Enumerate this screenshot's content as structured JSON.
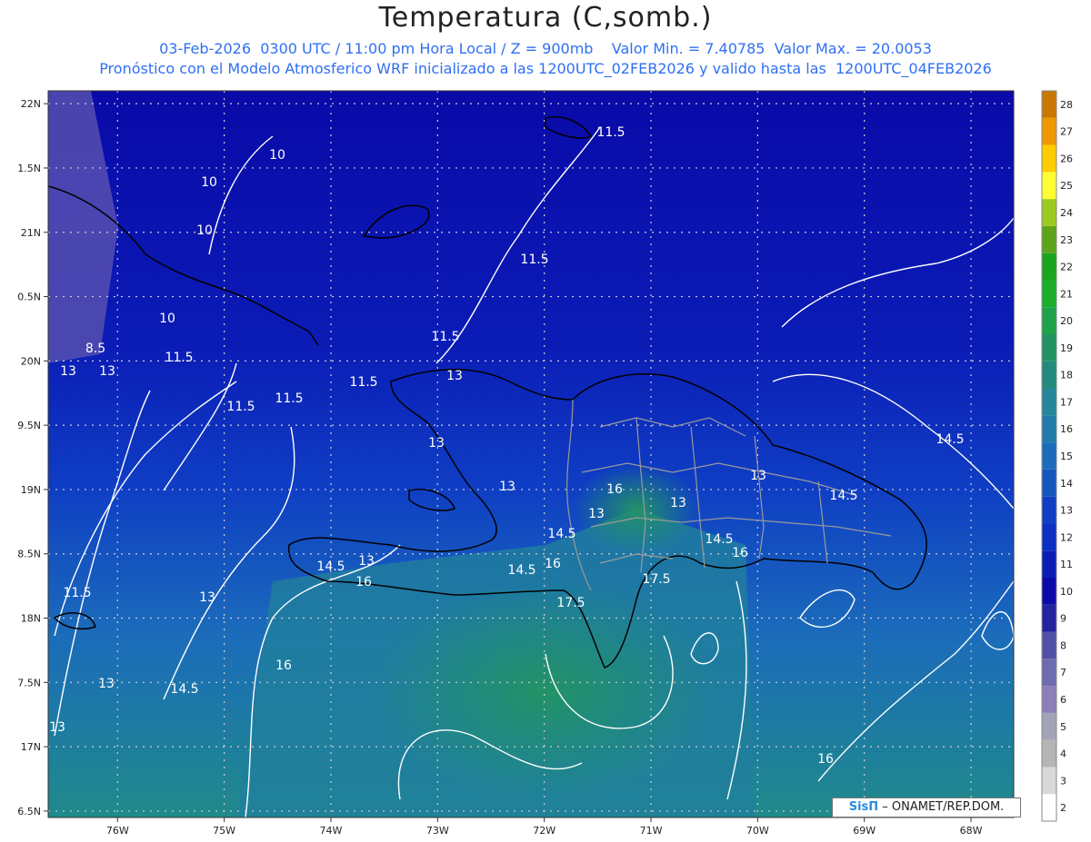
{
  "header": {
    "title": "Temperatura (C,somb.)",
    "line1": "03-Feb-2026  0300 UTC / 11:00 pm Hora Local / Z = 900mb    Valor Min. = 7.40785  Valor Max. = 20.0053",
    "line2": "Pronóstico con el Modelo Atmosferico WRF inicializado a las 1200UTC_02FEB2026 y valido hasta las  1200UTC_04FEB2026"
  },
  "map": {
    "lon_range": [
      -76.65,
      -67.6
    ],
    "lat_range": [
      16.45,
      22.1
    ],
    "x_ticks": [
      "76W",
      "75W",
      "74W",
      "73W",
      "72W",
      "71W",
      "70W",
      "69W",
      "68W"
    ],
    "y_ticks": [
      "22N",
      "1.5N",
      "21N",
      "0.5N",
      "20N",
      "9.5N",
      "19N",
      "8.5N",
      "18N",
      "7.5N",
      "17N",
      "6.5N"
    ],
    "contour_labels": [
      "11.5",
      "10",
      "10",
      "10",
      "10",
      "11.5",
      "13",
      "13",
      "14.5",
      "8.5",
      "11.5",
      "11.5",
      "11.5",
      "11.5",
      "11.5",
      "13",
      "13",
      "13",
      "16",
      "13",
      "13",
      "14.5",
      "13",
      "14.5",
      "14.5",
      "16",
      "14.5",
      "16",
      "17.5",
      "17.5",
      "14.5",
      "16",
      "13",
      "11.5",
      "13",
      "13",
      "14.5",
      "16",
      "13",
      "16"
    ],
    "colors": {
      "land_border": "#000000",
      "province_border": "#9a9a9a",
      "contour": "#ffffff",
      "grid": "#cfcfcf"
    }
  },
  "colorbar": {
    "levels": [
      "2",
      "3",
      "4",
      "5",
      "6",
      "7",
      "8",
      "9",
      "10",
      "11",
      "12",
      "13",
      "14",
      "15",
      "16",
      "17",
      "18",
      "19",
      "20",
      "21",
      "22",
      "23",
      "24",
      "25",
      "26",
      "27",
      "28"
    ],
    "colors": [
      "#ffffff",
      "#d9d9d9",
      "#b5b5b5",
      "#a3a3b8",
      "#8c7fb8",
      "#6e6cb0",
      "#5050a8",
      "#2323a0",
      "#0a0aa8",
      "#0b1cb6",
      "#0c2fc3",
      "#0f3fc4",
      "#1556c0",
      "#1b6cba",
      "#207bab",
      "#24879a",
      "#238a7e",
      "#229463",
      "#1ea24a",
      "#1aae2c",
      "#1aa51e",
      "#5ea41b",
      "#9acb1e",
      "#ffff33",
      "#ffcc00",
      "#ee9900",
      "#c87800"
    ]
  },
  "credit": {
    "logo": "SisΠ",
    "text": " – ONAMET/REP.DOM."
  }
}
